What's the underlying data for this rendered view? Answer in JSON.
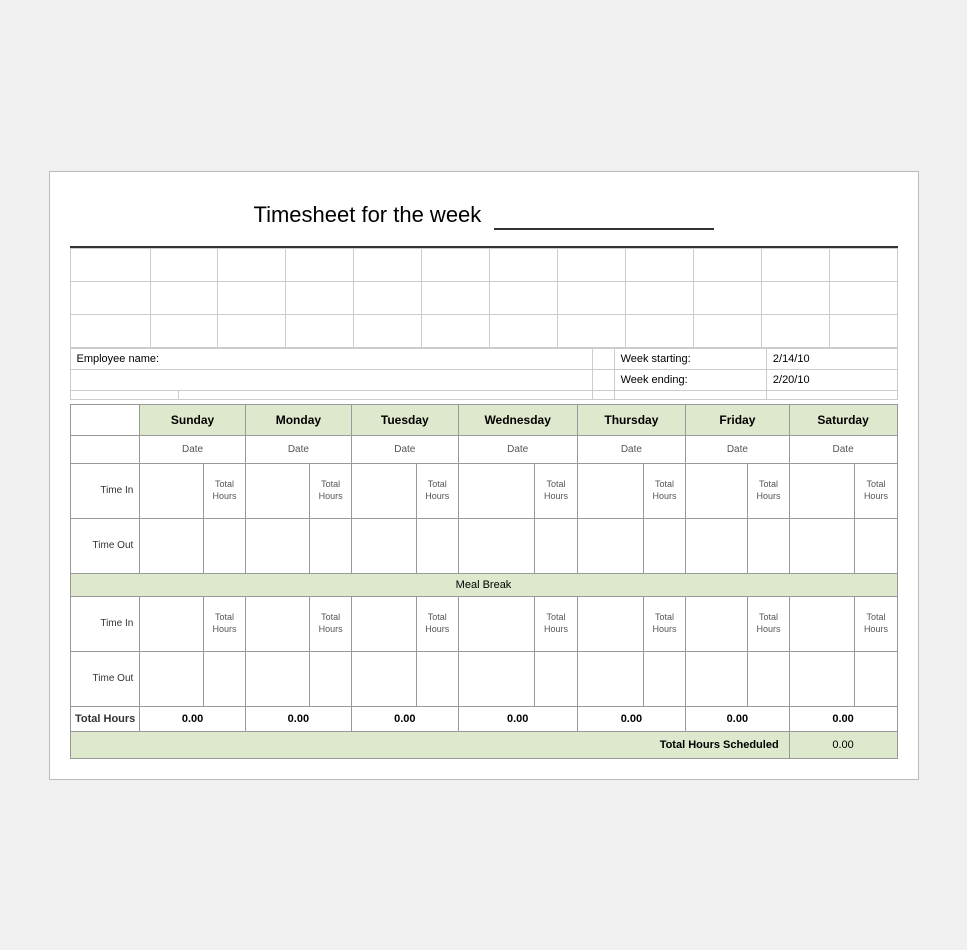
{
  "title": "Timesheet for the week",
  "employee_label": "Employee name:",
  "week_starting_label": "Week starting:",
  "week_starting_value": "2/14/10",
  "week_ending_label": "Week ending:",
  "week_ending_value": "2/20/10",
  "days": [
    "Sunday",
    "Monday",
    "Tuesday",
    "Wednesday",
    "Thursday",
    "Friday",
    "Saturday"
  ],
  "date_label": "Date",
  "time_in_label": "Time In",
  "time_out_label": "Time Out",
  "total_hours_label": "Total Hours",
  "hours_label": "Hours",
  "total_hours_col": "Total\nHours",
  "meal_break_label": "Meal Break",
  "total_hours_row_label": "Total Hours",
  "total_hours_scheduled_label": "Total Hours Scheduled",
  "zero_value": "0.00",
  "day_totals": [
    "0.00",
    "0.00",
    "0.00",
    "0.00",
    "0.00",
    "0.00",
    "0.00"
  ],
  "grand_total": "0.00"
}
